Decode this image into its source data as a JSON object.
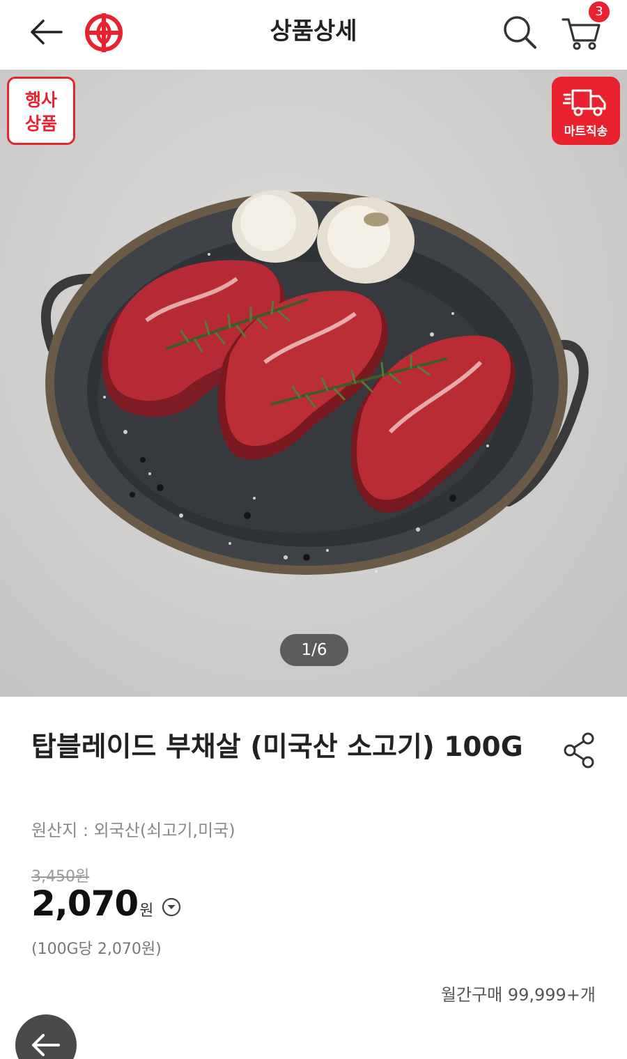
{
  "header": {
    "title": "상품상세",
    "cart_count": "3",
    "icons": [
      "back-arrow-icon",
      "brand-logo-icon",
      "search-icon",
      "cart-icon"
    ]
  },
  "hero": {
    "event_badge": [
      "행사",
      "상품"
    ],
    "mart_badge": "마트직송",
    "pager": "1/6"
  },
  "product": {
    "title": "탑블레이드 부채살 (미국산 소고기) 100G",
    "origin": "원산지 : 외국산(쇠고기,미국)",
    "original_price": "3,450원",
    "price": "2,070",
    "currency": "원",
    "unit_price": "(100G당 2,070원)",
    "monthly_purchases": "월간구매 99,999+개"
  },
  "colors": {
    "brand_red": "#e8222e",
    "text_dark": "#222222",
    "text_muted": "#888888"
  }
}
